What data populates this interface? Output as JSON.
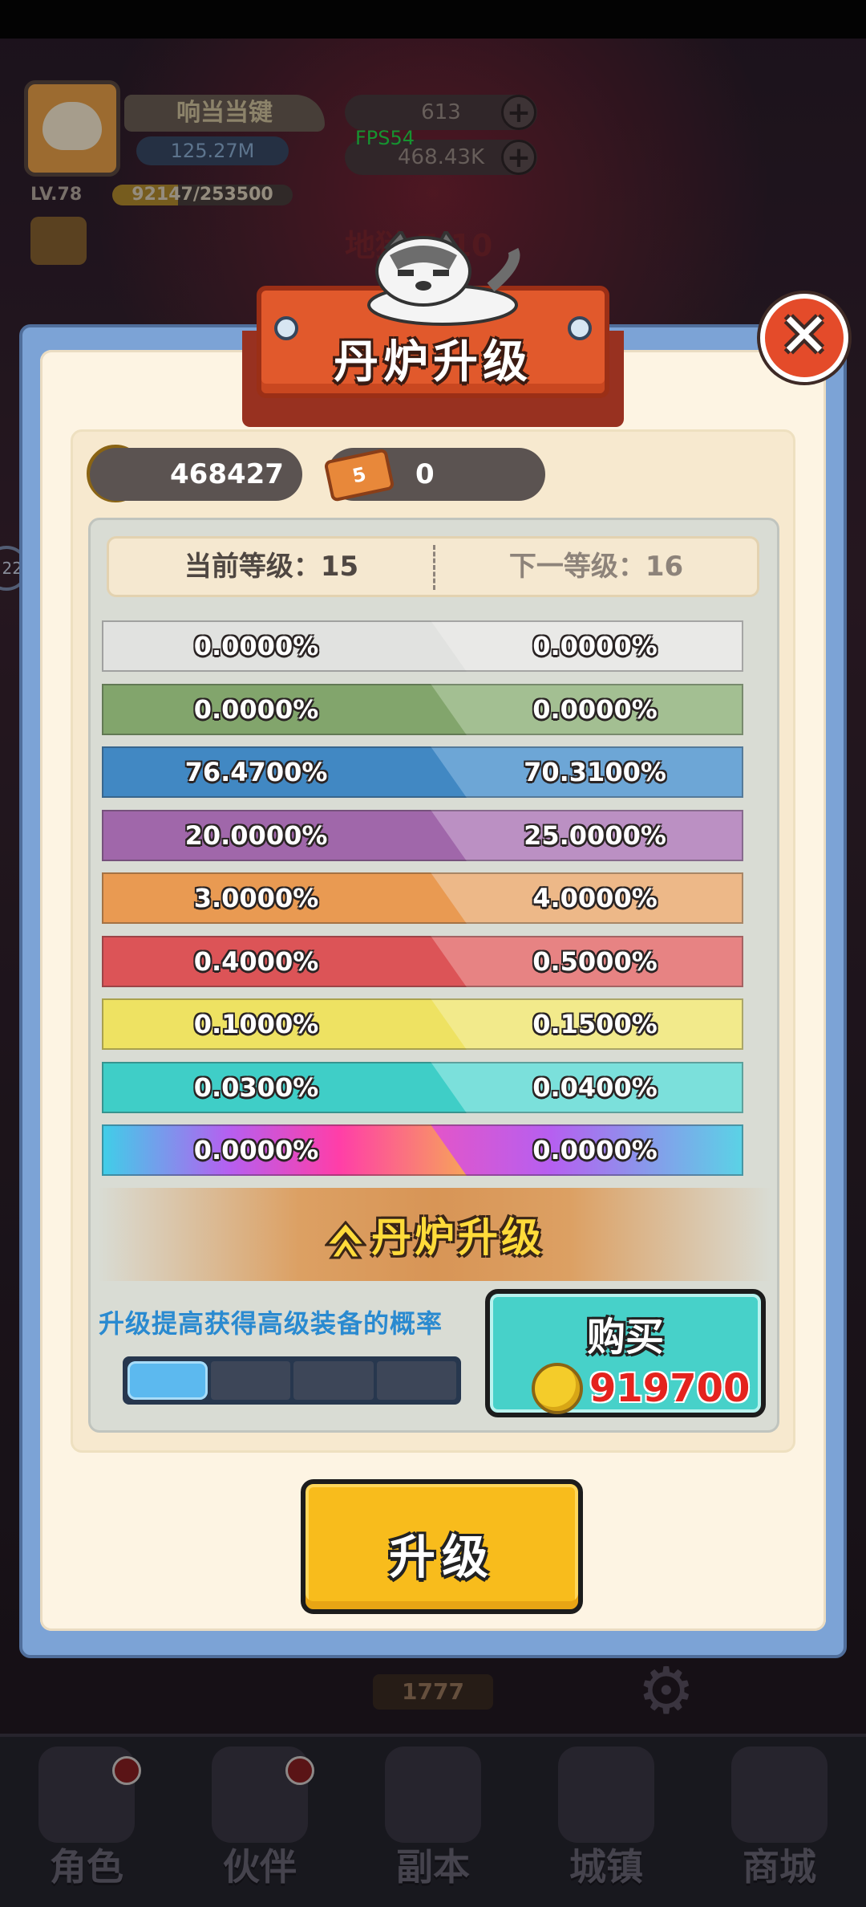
{
  "hud": {
    "player_name": "响当当键",
    "power": "125.27M",
    "level": "LV.78",
    "exp": "92147/253500",
    "exp_fraction": 0.3635,
    "gems": "613",
    "coins": "468.43K",
    "fps": "FPS54",
    "stage": "地狱 7-10",
    "counter": "1777",
    "side_badge": "22"
  },
  "bottom_nav": [
    {
      "label": "角色",
      "alert": true
    },
    {
      "label": "伙伴",
      "alert": true
    },
    {
      "label": "副本",
      "alert": false
    },
    {
      "label": "城镇",
      "alert": false
    },
    {
      "label": "商城",
      "alert": false
    }
  ],
  "modal": {
    "title": "丹炉升级",
    "close_symbol": "✕",
    "currency": {
      "coin_amount": "468427",
      "ticket_badge": "5",
      "ticket_amount": "0"
    },
    "level": {
      "current_label": "当前等级：15",
      "next_label": "下一等级：16"
    },
    "rates": [
      {
        "current": "0.0000%",
        "next": "0.0000%",
        "color": "#e1e2e0",
        "color_light": "#e9e9e7"
      },
      {
        "current": "0.0000%",
        "next": "0.0000%",
        "color": "#82a56c",
        "color_light": "#a3bf92"
      },
      {
        "current": "76.4700%",
        "next": "70.3100%",
        "color": "#4188c3",
        "color_light": "#6da6d6"
      },
      {
        "current": "20.0000%",
        "next": "25.0000%",
        "color": "#a067aa",
        "color_light": "#bb90c3"
      },
      {
        "current": "3.0000%",
        "next": "4.0000%",
        "color": "#e99a52",
        "color_light": "#edb888"
      },
      {
        "current": "0.4000%",
        "next": "0.5000%",
        "color": "#dc5457",
        "color_light": "#e78383"
      },
      {
        "current": "0.1000%",
        "next": "0.1500%",
        "color": "#eee262",
        "color_light": "#f2ea8b"
      },
      {
        "current": "0.0300%",
        "next": "0.0400%",
        "color": "#3fcec7",
        "color_light": "#7be0db"
      },
      {
        "current": "0.0000%",
        "next": "0.0000%",
        "color": "rainbow",
        "color_light": "rainbow"
      }
    ],
    "upgrade_banner": "丹炉升级",
    "hint": "升级提高获得高级装备的概率",
    "progress": {
      "filled": 1,
      "total": 4
    },
    "buy": {
      "label": "购买",
      "price": "919700"
    },
    "upgrade_button": "升级"
  }
}
